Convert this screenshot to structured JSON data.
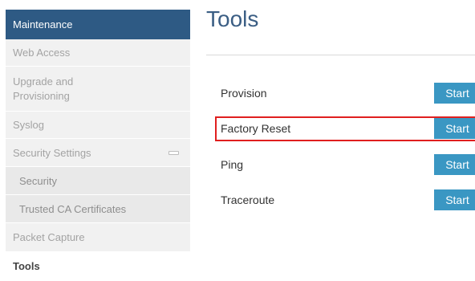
{
  "sidebar": {
    "header": "Maintenance",
    "items": [
      {
        "label": "Web Access"
      },
      {
        "label": "Upgrade and Provisioning"
      },
      {
        "label": "Syslog"
      },
      {
        "label": "Security Settings"
      },
      {
        "label": "Security"
      },
      {
        "label": "Trusted CA Certificates"
      },
      {
        "label": "Packet Capture"
      },
      {
        "label": "Tools"
      }
    ]
  },
  "main": {
    "title": "Tools",
    "tools": [
      {
        "label": "Provision",
        "button": "Start"
      },
      {
        "label": "Factory Reset",
        "button": "Start"
      },
      {
        "label": "Ping",
        "button": "Start"
      },
      {
        "label": "Traceroute",
        "button": "Start"
      }
    ]
  },
  "colors": {
    "header_bg": "#2e5a84",
    "title": "#3b5e84",
    "button_bg": "#3a97c3",
    "highlight": "#e01f1f"
  },
  "icons": {
    "collapse": "minus-icon"
  }
}
